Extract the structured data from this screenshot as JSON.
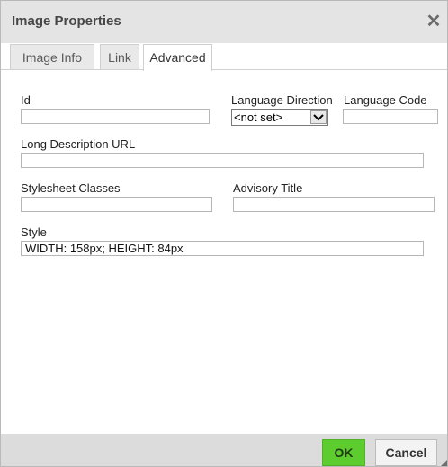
{
  "dialog": {
    "title": "Image Properties",
    "close_icon": "close-icon",
    "tabs": [
      {
        "label": "Image Info",
        "active": false
      },
      {
        "label": "Link",
        "active": false
      },
      {
        "label": "Advanced",
        "active": true
      }
    ]
  },
  "form": {
    "id_label": "Id",
    "id_value": "",
    "lang_dir_label": "Language Direction",
    "lang_dir_value": "<not set>",
    "lang_code_label": "Language Code",
    "lang_code_value": "",
    "long_desc_label": "Long Description URL",
    "long_desc_value": "",
    "stylesheet_label": "Stylesheet Classes",
    "stylesheet_value": "",
    "advisory_label": "Advisory Title",
    "advisory_value": "",
    "style_label": "Style",
    "style_value": "WIDTH: 158px; HEIGHT: 84px"
  },
  "footer": {
    "ok_label": "OK",
    "cancel_label": "Cancel"
  },
  "colors": {
    "ok_button": "#5ccc2e",
    "titlebar": "#e4e4e4",
    "footer": "#dcdcdc"
  }
}
